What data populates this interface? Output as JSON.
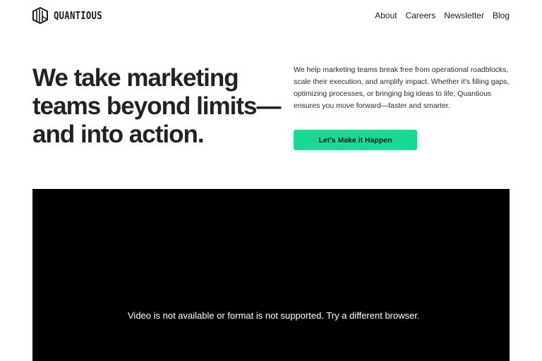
{
  "brand": {
    "name": "QUANTIOUS",
    "logo_icon": "quantious-cube-icon"
  },
  "nav": {
    "items": [
      {
        "label": "About"
      },
      {
        "label": "Careers"
      },
      {
        "label": "Newsletter"
      },
      {
        "label": "Blog"
      }
    ]
  },
  "hero": {
    "headline": "We take marketing teams beyond limits—and into action.",
    "description": "We help marketing teams break free from operational roadblocks, scale their execution, and amplify impact. Whether it's filling gaps, optimizing processes, or bringing big ideas to life, Quantious ensures you move forward—faster and smarter.",
    "cta_label": "Let's Make it Happen"
  },
  "video": {
    "message": "Video is not available or format is not supported. Try a different browser."
  },
  "colors": {
    "accent": "#17d992",
    "text": "#1a1a1a",
    "video_background": "#000000"
  }
}
